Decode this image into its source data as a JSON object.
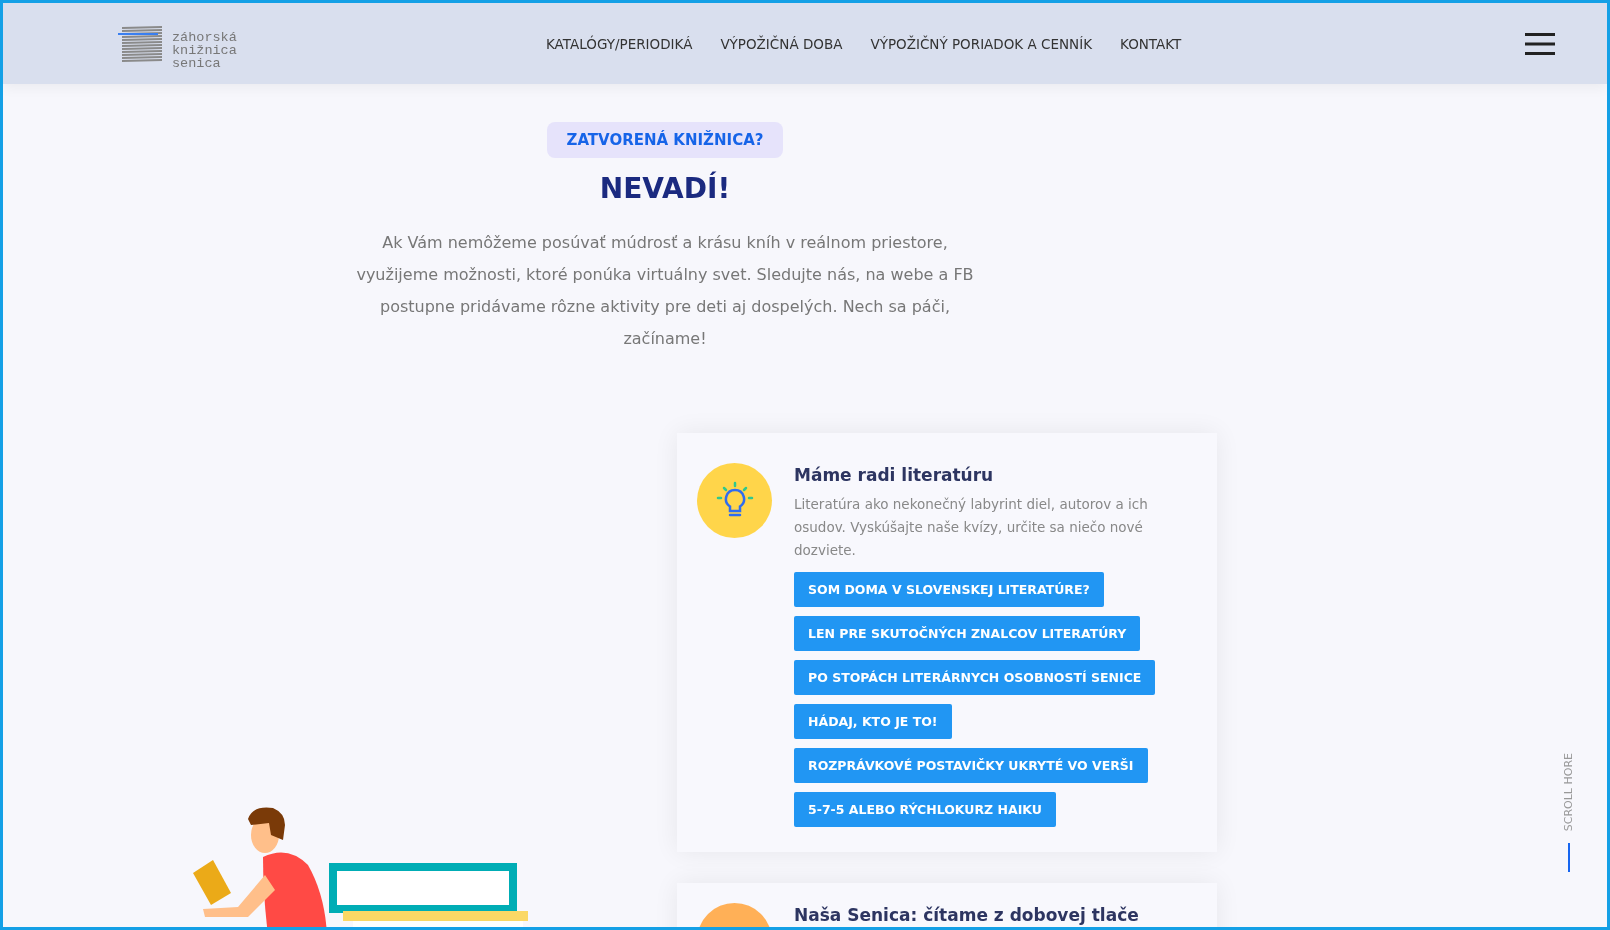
{
  "logo": {
    "lines": [
      "záhorská",
      "knižnica",
      "senica"
    ]
  },
  "nav": {
    "items": [
      "KATALÓGY/PERIODIKÁ",
      "VÝPOŽIČNÁ DOBA",
      "VÝPOŽIČNÝ PORIADOK A CENNÍK",
      "KONTAKT"
    ]
  },
  "hero": {
    "badge": "ZATVORENÁ KNIŽNICA?",
    "title": "NEVADÍ!",
    "text": "Ak Vám nemôžeme posúvať múdrosť a krásu kníh v reálnom priestore, využijeme možnosti, ktoré ponúka virtuálny svet. Sledujte nás, na webe a FB postupne pridávame rôzne aktivity pre deti aj dospelých. Nech sa páči, začíname!"
  },
  "cards": [
    {
      "color": "#ffd54a",
      "kind": "bulb",
      "title": "Máme radi literatúru",
      "text": "Literatúra ako nekonečný labyrint diel, autorov a ich osudov. Vyskúšajte naše kvízy, určite sa niečo nové dozviete.",
      "buttons": [
        "SOM DOMA V SLOVENSKEJ LITERATÚRE?",
        "LEN PRE SKUTOČNÝCH ZNALCOV LITERATÚRY",
        "PO STOPÁCH LITERÁRNYCH OSOBNOSTÍ SENICE",
        "HÁDAJ, KTO JE TO!",
        "ROZPRÁVKOVÉ POSTAVIČKY UKRYTÉ VO VERŠI",
        "5-7-5 ALEBO RÝCHLOKURZ HAIKU"
      ]
    },
    {
      "color": "#ffb057",
      "kind": "plain",
      "title": "Naša Senica: čítame z dobovej tlače"
    }
  ],
  "scroll_hint": "SCROLL HORE"
}
